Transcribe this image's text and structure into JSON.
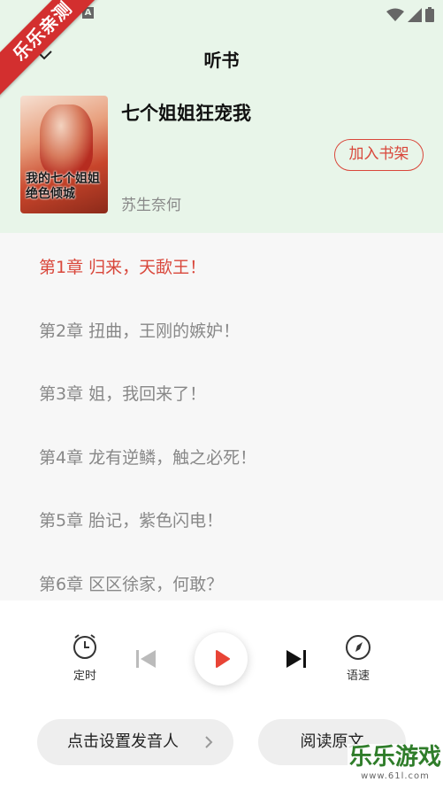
{
  "watermark": {
    "ribbon_text": "乐乐亲测",
    "logo_text": "乐乐游戏",
    "url": "www.61l.com"
  },
  "header": {
    "title": "听书"
  },
  "book": {
    "title": "七个姐姐狂宠我",
    "author": "苏生奈何",
    "cover_text": "我的七个姐姐绝色倾城",
    "shelf_button": "加入书架"
  },
  "chapters": [
    {
      "label": "第1章  归来，天歃王！",
      "active": true
    },
    {
      "label": "第2章 扭曲，王刚的嫉妒！",
      "active": false
    },
    {
      "label": "第3章 姐，我回来了！",
      "active": false
    },
    {
      "label": "第4章 龙有逆鳞，触之必死！",
      "active": false
    },
    {
      "label": "第5章 胎记，紫色闪电！",
      "active": false
    },
    {
      "label": "第6章 区区徐家，何敢？",
      "active": false
    }
  ],
  "player": {
    "timer_label": "定时",
    "speed_label": "语速",
    "voice_button": "点击设置发音人",
    "original_button": "阅读原文"
  },
  "colors": {
    "accent": "#d9473b",
    "header_bg": "#e8f5e9",
    "ribbon": "#d32f2f"
  },
  "icons": [
    "back-chevron-icon",
    "timer-icon",
    "previous-icon",
    "play-icon",
    "next-icon",
    "speed-icon",
    "chevron-right-icon"
  ]
}
